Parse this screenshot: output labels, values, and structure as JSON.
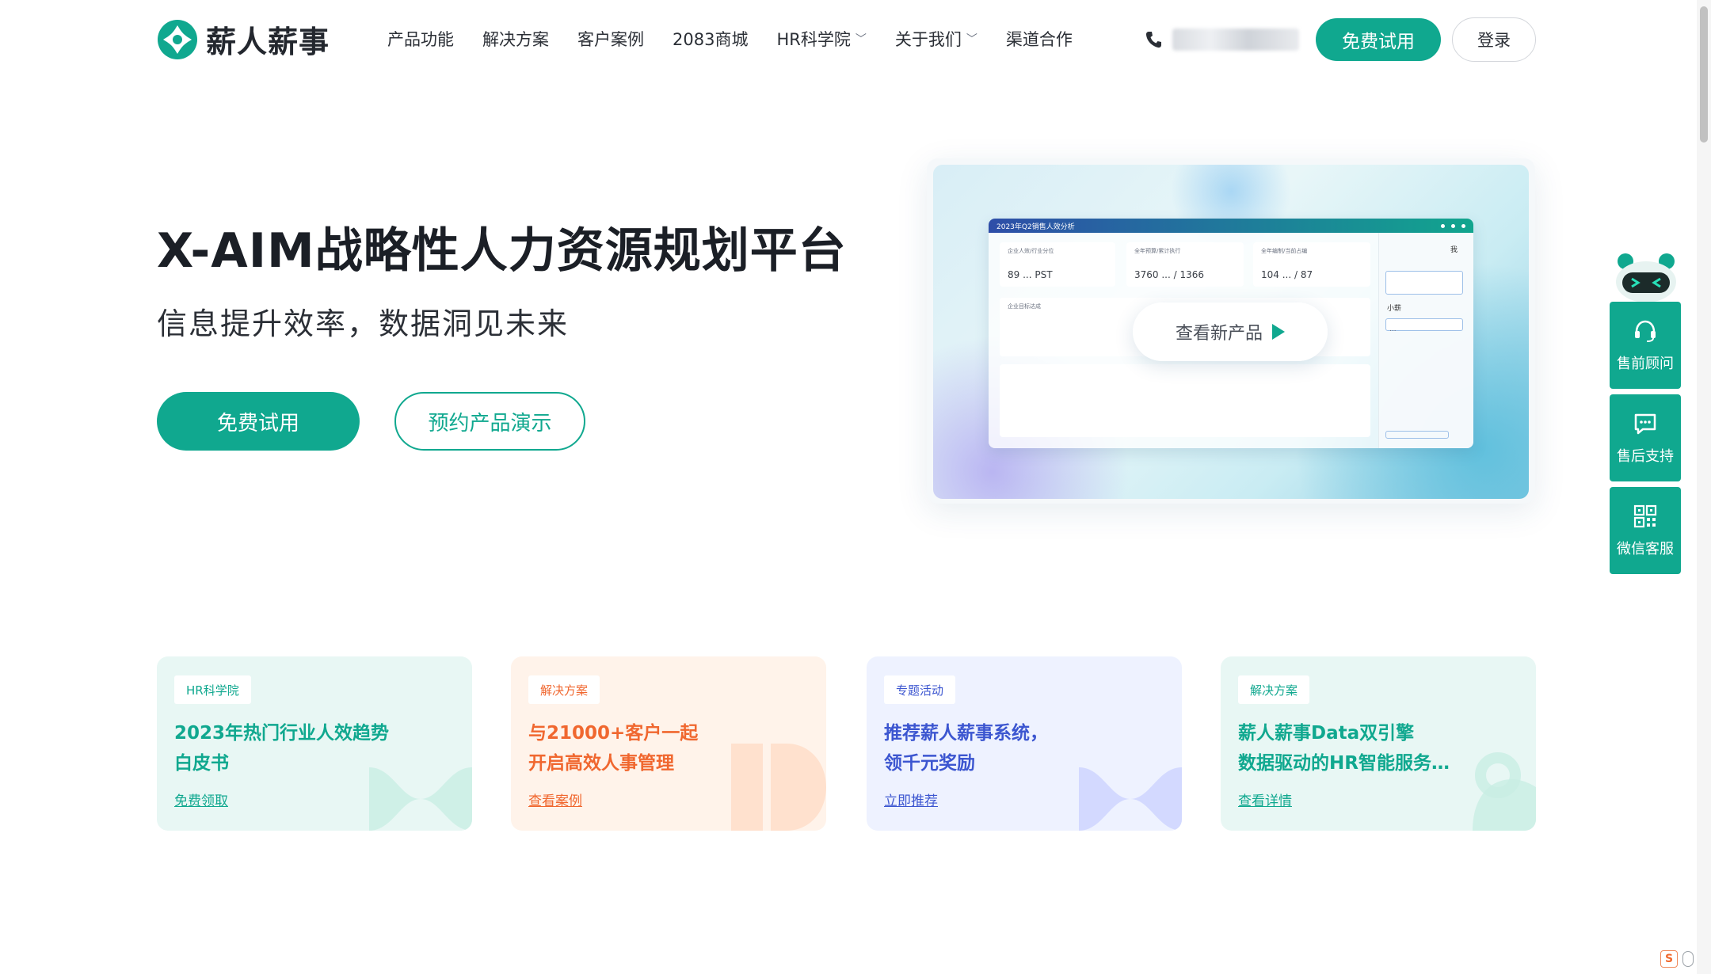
{
  "brand": {
    "name": "薪人薪事",
    "accent": "#10a88f"
  },
  "nav": {
    "items": [
      {
        "label": "产品功能",
        "dropdown": false
      },
      {
        "label": "解决方案",
        "dropdown": false
      },
      {
        "label": "客户案例",
        "dropdown": false
      },
      {
        "label": "2083商城",
        "dropdown": false
      },
      {
        "label": "HR科学院",
        "dropdown": true
      },
      {
        "label": "关于我们",
        "dropdown": true
      },
      {
        "label": "渠道合作",
        "dropdown": false
      }
    ],
    "trial_label": "免费试用",
    "login_label": "登录",
    "phone_icon": "phone-icon"
  },
  "hero": {
    "title": "X-AIM战略性人力资源规划平台",
    "subtitle": "信息提升效率，数据洞见未来",
    "trial_label": "免费试用",
    "demo_label": "预约产品演示"
  },
  "preview": {
    "window_title": "2023年Q2销售人效分析",
    "play_label": "查看新产品",
    "cards": [
      {
        "label": "企业人效/行业分位",
        "value": "89 ... PST"
      },
      {
        "label": "全年预算/累计执行",
        "value": "3760 ... / 1366"
      },
      {
        "label": "全年编制/当前占编",
        "value": "104 ... / 87"
      }
    ],
    "chart_label": "企业目标达成",
    "side_me": "我",
    "side_bot": "小薪",
    "side_dots": "..."
  },
  "promo_cards": [
    {
      "tag": "HR科学院",
      "title": "2023年热门行业人效趋势\n白皮书",
      "link": "免费领取",
      "color": "#10a88f"
    },
    {
      "tag": "解决方案",
      "title": "与21000+客户一起\n开启高效人事管理",
      "link": "查看案例",
      "color": "#f0672f"
    },
    {
      "tag": "专题活动",
      "title": "推荐薪人薪事系统，\n领千元奖励",
      "link": "立即推荐",
      "color": "#3c56d0"
    },
    {
      "tag": "解决方案",
      "title": "薪人薪事Data双引擎\n数据驱动的HR智能服务…",
      "link": "查看详情",
      "color": "#10a88f"
    }
  ],
  "floating": {
    "presale_label": "售前顾问",
    "aftersale_label": "售后支持",
    "wechat_label": "微信客服"
  },
  "tray": {
    "ime_label": "S"
  }
}
